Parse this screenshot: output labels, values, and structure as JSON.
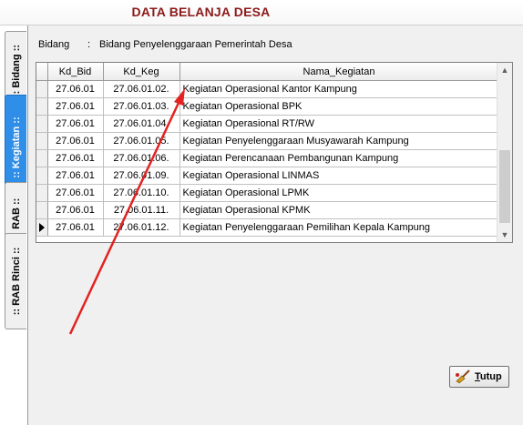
{
  "window": {
    "title": "DATA BELANJA DESA"
  },
  "tabs": [
    {
      "label": ":: Bidang ::",
      "active": false
    },
    {
      "label": ":: Kegiatan ::",
      "active": true
    },
    {
      "label": ":: RAB ::",
      "active": false
    },
    {
      "label": ":: RAB Rinci ::",
      "active": false
    }
  ],
  "bidang": {
    "label": "Bidang",
    "separator": ":",
    "value": "Bidang Penyelenggaraan Pemerintah Desa"
  },
  "grid": {
    "columns": [
      "Kd_Bid",
      "Kd_Keg",
      "Nama_Kegiatan"
    ],
    "rows": [
      [
        "27.06.01",
        "27.06.01.02.",
        "Kegiatan Operasional Kantor Kampung"
      ],
      [
        "27.06.01",
        "27.06.01.03.",
        "Kegiatan Operasional BPK"
      ],
      [
        "27.06.01",
        "27.06.01.04.",
        "Kegiatan Operasional RT/RW"
      ],
      [
        "27.06.01",
        "27.06.01.05.",
        "Kegiatan Penyelenggaraan Musyawarah Kampung"
      ],
      [
        "27.06.01",
        "27.06.01.06.",
        "Kegiatan Perencanaan Pembangunan Kampung"
      ],
      [
        "27.06.01",
        "27.06.01.09.",
        "Kegiatan Operasional LINMAS"
      ],
      [
        "27.06.01",
        "27.06.01.10.",
        "Kegiatan  Operasional LPMK"
      ],
      [
        "27.06.01",
        "27.06.01.11.",
        "Kegiatan Operasional KPMK"
      ],
      [
        "27.06.01",
        "27.06.01.12.",
        "Kegiatan Penyelenggaraan Pemilihan Kepala Kampung"
      ]
    ],
    "current_row_index": 8
  },
  "buttons": {
    "tutup_first": "T",
    "tutup_rest": "utup",
    "tutup_icon": "broom-icon"
  },
  "annotation": {
    "color": "#e32222"
  },
  "colors": {
    "title": "#8b1a1a",
    "active_tab": "#2f8fe8"
  }
}
